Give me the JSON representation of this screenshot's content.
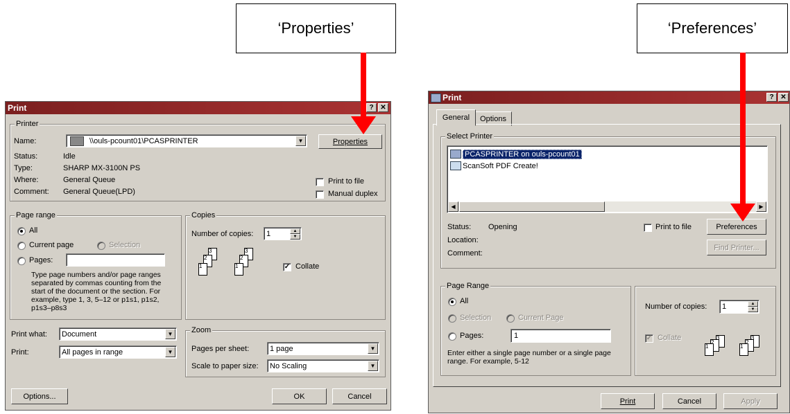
{
  "callouts": {
    "left": "‘Properties’",
    "right": "‘Preferences’"
  },
  "left_dialog": {
    "title": "Print",
    "title_buttons": [
      "?",
      "✕"
    ],
    "printer_group": "Printer",
    "name_label": "Name:",
    "name_value": "\\\\ouls-pcount01\\PCASPRINTER",
    "properties_button": "Properties",
    "status_label": "Status:",
    "status_value": "Idle",
    "type_label": "Type:",
    "type_value": "SHARP MX-3100N PS",
    "where_label": "Where:",
    "where_value": "General Queue",
    "comment_label": "Comment:",
    "comment_value": "General Queue(LPD)",
    "print_to_file": "Print to file",
    "manual_duplex": "Manual duplex",
    "page_range_group": "Page range",
    "all": "All",
    "current_page": "Current page",
    "selection": "Selection",
    "pages": "Pages:",
    "pages_help": "Type page numbers and/or page ranges separated by commas counting from the start of the document or the section. For example, type 1, 3, 5–12 or p1s1, p1s2, p1s3–p8s3",
    "copies_group": "Copies",
    "number_of_copies": "Number of copies:",
    "copies_value": "1",
    "collate": "Collate",
    "print_what_label": "Print what:",
    "print_what_value": "Document",
    "print_label": "Print:",
    "print_value": "All pages in range",
    "zoom_group": "Zoom",
    "pages_per_sheet_label": "Pages per sheet:",
    "pages_per_sheet_value": "1 page",
    "scale_label": "Scale to paper size:",
    "scale_value": "No Scaling",
    "options_button": "Options...",
    "ok_button": "OK",
    "cancel_button": "Cancel"
  },
  "right_dialog": {
    "title": "Print",
    "title_buttons": [
      "?",
      "✕"
    ],
    "tabs": [
      "General",
      "Options"
    ],
    "select_printer_group": "Select Printer",
    "printers": [
      "PCASPRINTER on ouls-pcount01",
      "ScanSoft PDF Create!"
    ],
    "status_label": "Status:",
    "status_value": "Opening",
    "location_label": "Location:",
    "comment_label": "Comment:",
    "print_to_file": "Print to file",
    "preferences_button": "Preferences",
    "find_printer_button": "Find Printer...",
    "page_range_group": "Page Range",
    "all": "All",
    "selection": "Selection",
    "current_page": "Current Page",
    "pages": "Pages:",
    "pages_value": "1",
    "pages_help": "Enter either a single page number or a single page range.  For example, 5-12",
    "number_of_copies": "Number of copies:",
    "copies_value": "1",
    "collate": "Collate",
    "print_button": "Print",
    "cancel_button": "Cancel",
    "apply_button": "Apply"
  },
  "colors": {
    "title_left": "#7b1f1f",
    "title_right": "#7b1f1f",
    "arrow": "#ff0000",
    "dialog_bg": "#d4d0c8",
    "selection": "#0a246a"
  }
}
